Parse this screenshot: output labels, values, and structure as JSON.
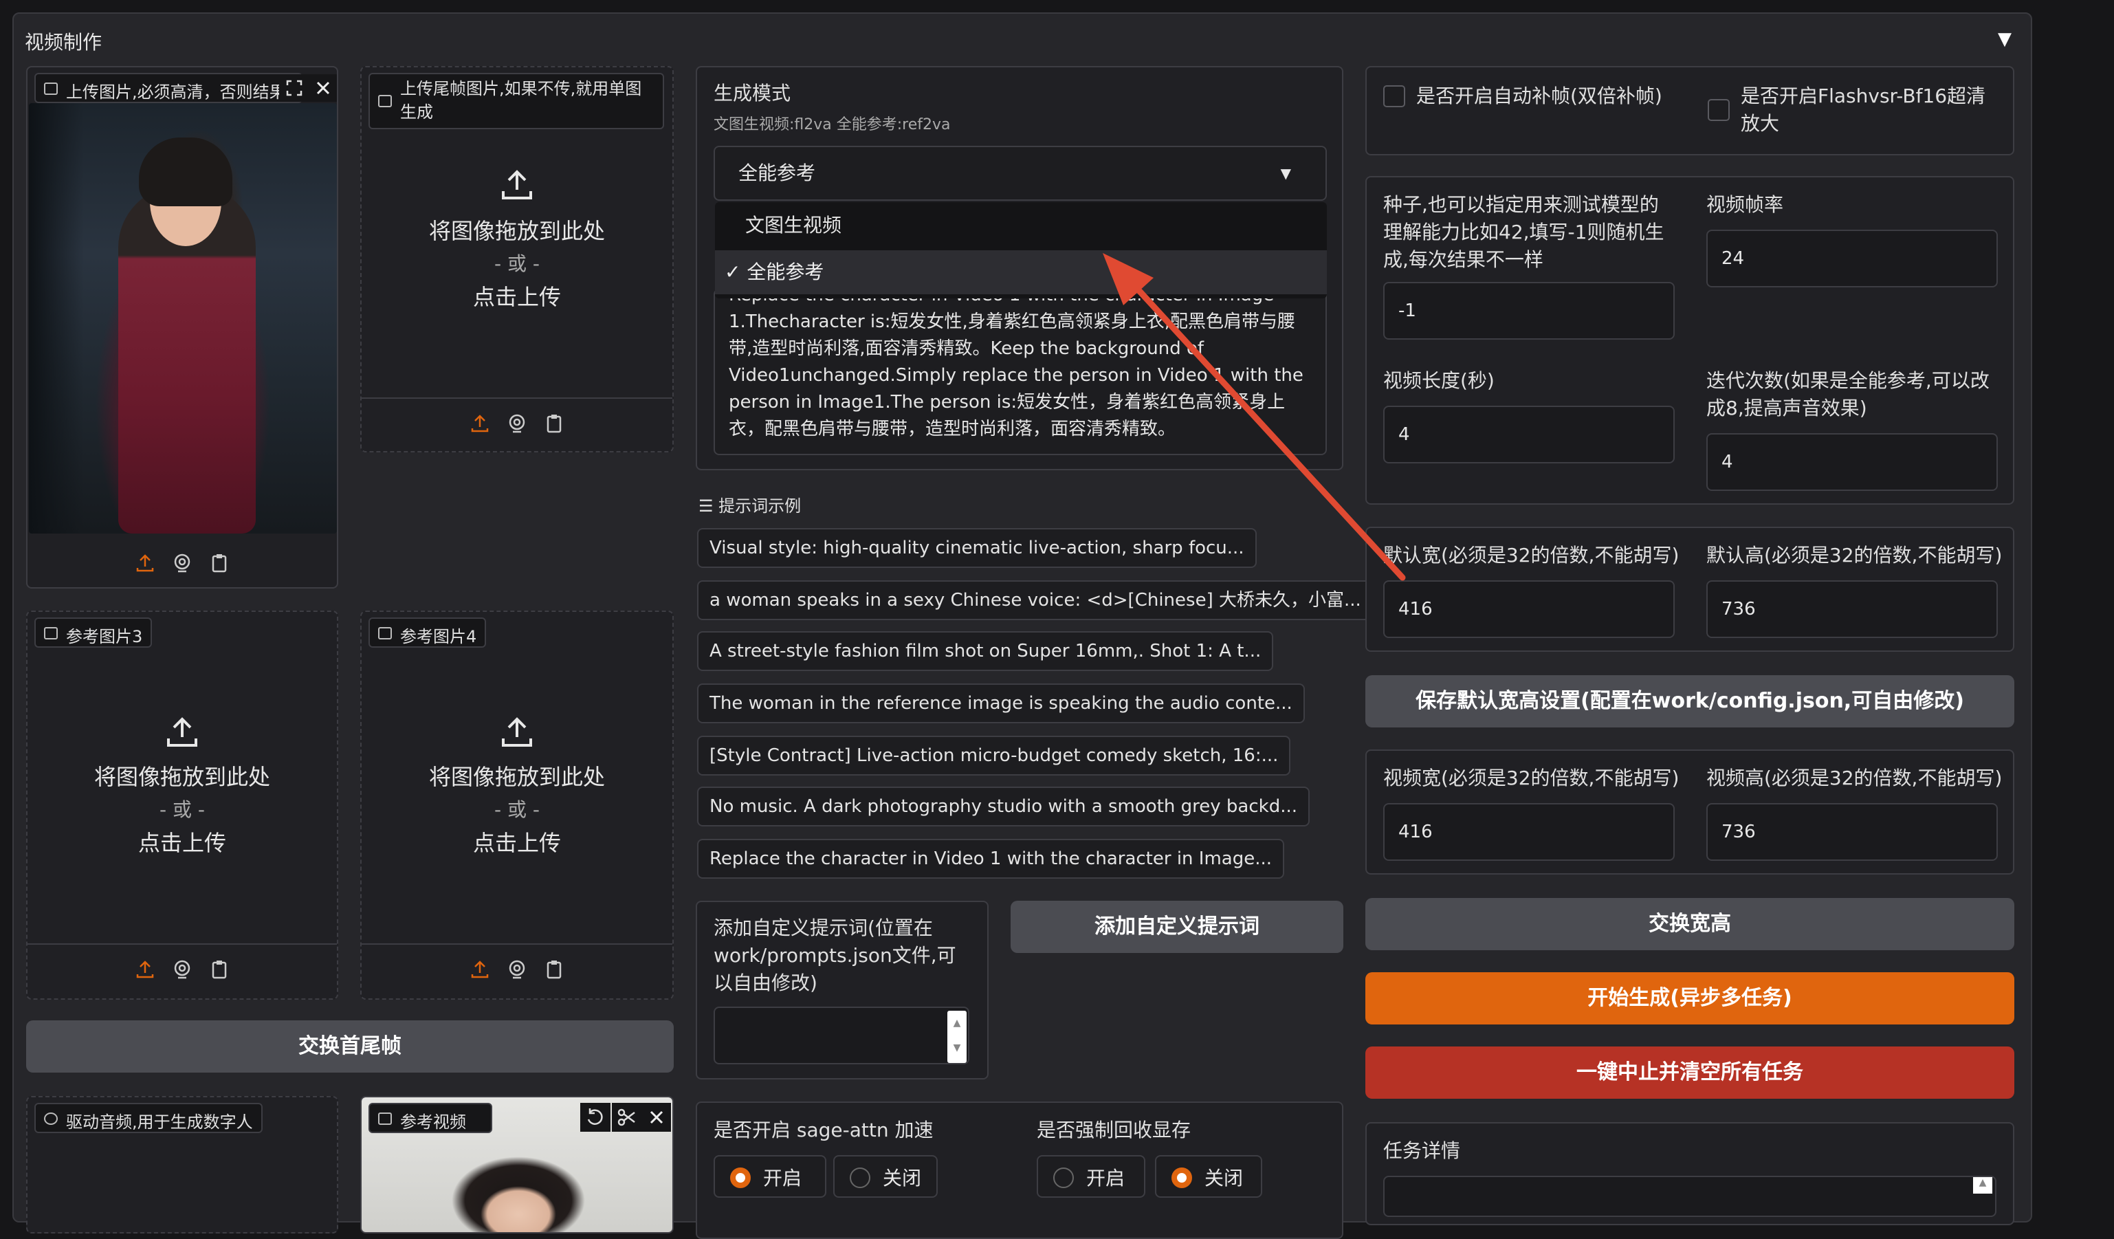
{
  "panel": {
    "title": "视频制作",
    "collapse_icon": "caret-down-icon"
  },
  "upload_main": {
    "label": "上传图片,必须高清，否则结果"
  },
  "upload_tail": {
    "label": "上传尾帧图片,如果不传,就用单图生成"
  },
  "ref3": {
    "label": "参考图片3"
  },
  "ref4": {
    "label": "参考图片4"
  },
  "upload_text": {
    "drop": "将图像拖放到此处",
    "or": "- 或 -",
    "click": "点击上传"
  },
  "swap_frames": "交换首尾帧",
  "audio": {
    "label": "驱动音频,用于生成数字人"
  },
  "ref_video": {
    "label": "参考视频"
  },
  "mode": {
    "label": "生成模式",
    "hint": "文图生视频:fl2va 全能参考:ref2va",
    "selected": "全能参考",
    "options": [
      "文图生视频",
      "✓ 全能参考"
    ]
  },
  "prompt_text": "Replace the character in Video 1 with the character in Image 1.Thecharacter is:短发女性,身着紫红色高领紧身上衣,配黑色肩带与腰带,造型时尚利落,面容清秀精致。Keep the background of Video1unchanged.Simply replace the person in Video 1 with the person in Image1.The person is:短发女性，身着紫红色高领紧身上衣，配黑色肩带与腰带，造型时尚利落，面容清秀精致。",
  "examples": {
    "title": "提示词示例",
    "items": [
      "Visual style: high-quality cinematic live-action, sharp focu...",
      "a woman speaks in a sexy Chinese voice: <d>[Chinese] 大桥未久，小富...",
      "A street-style fashion film shot on Super 16mm,. Shot 1: A t...",
      "The woman in the reference image is speaking the audio conte...",
      "[Style Contract] Live-action micro-budget comedy sketch, 16:...",
      "No music. A dark photography studio with a smooth grey backd...",
      "Replace the character in Video 1 with the character in Image..."
    ]
  },
  "custom_prompt": {
    "label": "添加自定义提示词(位置在work/prompts.json文件,可以自由修改)",
    "value": "",
    "button": "添加自定义提示词"
  },
  "sage": {
    "label": "是否开启 sage-attn 加速",
    "on": "开启",
    "off": "关闭",
    "value": "开启"
  },
  "gc": {
    "label": "是否强制回收显存",
    "on": "开启",
    "off": "关闭",
    "value": "关闭"
  },
  "checks": {
    "interp": "是否开启自动补帧(双倍补帧)",
    "flashsvr": "是否开启Flashvsr-Bf16超清放大"
  },
  "seed": {
    "label": "种子,也可以指定用来测试模型的理解能力比如42,填写-1则随机生成,每次结果不一样",
    "value": "-1"
  },
  "fps": {
    "label": "视频帧率",
    "value": "24"
  },
  "length": {
    "label": "视频长度(秒)",
    "value": "4"
  },
  "iters": {
    "label": "迭代次数(如果是全能参考,可以改成8,提高声音效果)",
    "value": "4"
  },
  "default_w": {
    "label": "默认宽(必须是32的倍数,不能胡写)",
    "value": "416"
  },
  "default_h": {
    "label": "默认高(必须是32的倍数,不能胡写)",
    "value": "736"
  },
  "save_default": "保存默认宽高设置(配置在work/config.json,可自由修改)",
  "video_w": {
    "label": "视频宽(必须是32的倍数,不能胡写)",
    "value": "416"
  },
  "video_h": {
    "label": "视频高(必须是32的倍数,不能胡写)",
    "value": "736"
  },
  "swap_wh": "交换宽高",
  "start": "开始生成(异步多任务)",
  "stop": "一键中止并清空所有任务",
  "task": {
    "label": "任务详情"
  },
  "colors": {
    "accent": "#e0650e",
    "danger": "#b63225",
    "button": "#4b4c52",
    "annotation": "#e04a32"
  }
}
